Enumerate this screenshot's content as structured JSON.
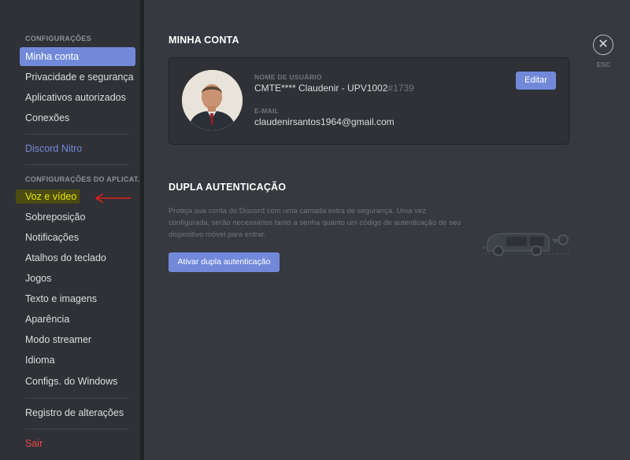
{
  "sidebar": {
    "section_user": "CONFIGURAÇÕES",
    "user_items": [
      "Minha conta",
      "Privacidade e segurança",
      "Aplicativos autorizados",
      "Conexões"
    ],
    "nitro": "Discord Nitro",
    "section_app": "CONFIGURAÇÕES DO APLICAT...",
    "app_items": [
      "Voz e vídeo",
      "Sobreposição",
      "Notificações",
      "Atalhos do teclado",
      "Jogos",
      "Texto e imagens",
      "Aparência",
      "Modo streamer",
      "Idioma",
      "Configs. do Windows"
    ],
    "changelog": "Registro de alterações",
    "logout": "Sair"
  },
  "account": {
    "title": "MINHA CONTA",
    "username_label": "NOME DE USUÁRIO",
    "username": "CMTE**** Claudenir - UPV1002",
    "discriminator": "#1739",
    "email_label": "E-MAIL",
    "email": "claudenirsantos1964@gmail.com",
    "edit_label": "Editar"
  },
  "twofa": {
    "title": "DUPLA AUTENTICAÇÃO",
    "description": "Proteja sua conta do Discord com uma camada extra de segurança. Uma vez configurada, serão necessários tanto a senha quanto um código de autenticação de seu dispositivo móvel para entrar.",
    "button": "Ativar dupla autenticação"
  },
  "close": {
    "icon": "close-icon",
    "glyph": "✕",
    "label": "ESC"
  },
  "colors": {
    "accent": "#7289da",
    "danger": "#f04747",
    "highlight": "#e6e600",
    "annotation": "#e0201c"
  }
}
